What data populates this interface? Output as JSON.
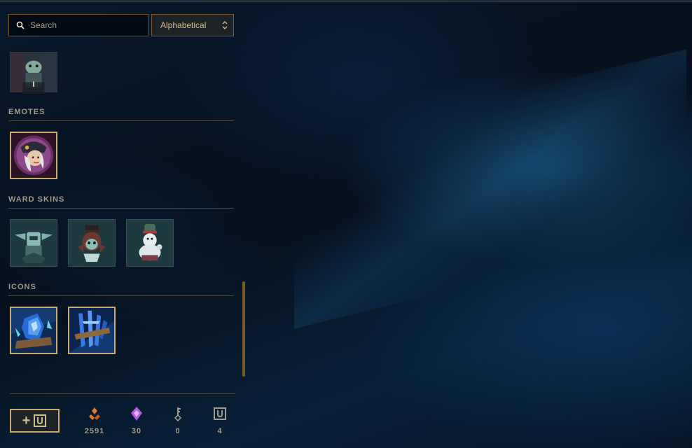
{
  "search": {
    "placeholder": "Search",
    "icon": "search-icon"
  },
  "sort": {
    "selected": "Alphabetical",
    "icon": "chevron-updown-icon"
  },
  "top_item": {
    "badge": "I"
  },
  "sections": {
    "emotes": {
      "title": "EMOTES"
    },
    "ward_skins": {
      "title": "WARD SKINS"
    },
    "icons": {
      "title": "ICONS"
    }
  },
  "footer": {
    "add_button": {
      "symbol": "+",
      "icon": "loot-chest-icon"
    },
    "currencies": [
      {
        "name": "orange-essence",
        "icon": "orange-essence-icon",
        "value": "2591",
        "color": "#e07b2a"
      },
      {
        "name": "mythic-essence",
        "icon": "mythic-essence-icon",
        "value": "30",
        "color": "#b05ae0"
      },
      {
        "name": "keys",
        "icon": "key-icon",
        "value": "0",
        "color": "#a09b8c"
      },
      {
        "name": "chests",
        "icon": "chest-icon",
        "value": "4",
        "color": "#a09b8c"
      }
    ]
  },
  "colors": {
    "gold": "#c8aa6e",
    "dark_gold": "#785a28",
    "text": "#a09b8c"
  }
}
